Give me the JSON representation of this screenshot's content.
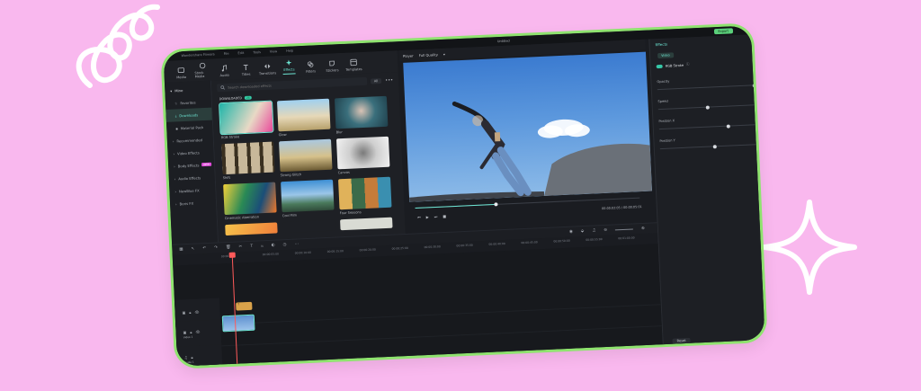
{
  "colors": {
    "background": "#f9b8ee",
    "frame_border": "#8fe36f",
    "app_bg": "#1a1c21",
    "accent": "#6ee7d5",
    "playhead": "#ff5a5a"
  },
  "topbar": {
    "menus": [
      "Wondershare Filmora",
      "File",
      "Edit",
      "Tools",
      "View",
      "Help"
    ],
    "title": "Untitled",
    "export_label": "Export"
  },
  "toolbar": {
    "tools": [
      {
        "label": "Media",
        "icon": "media-icon"
      },
      {
        "label": "Stock Media",
        "icon": "stock-media-icon"
      },
      {
        "label": "Audio",
        "icon": "audio-icon"
      },
      {
        "label": "Titles",
        "icon": "titles-icon"
      },
      {
        "label": "Transitions",
        "icon": "transitions-icon"
      },
      {
        "label": "Effects",
        "icon": "effects-icon",
        "active": true
      },
      {
        "label": "Filters",
        "icon": "filters-icon"
      },
      {
        "label": "Stickers",
        "icon": "stickers-icon"
      },
      {
        "label": "Templates",
        "icon": "templates-icon"
      }
    ]
  },
  "sidebar": {
    "items": [
      {
        "label": "Mine",
        "type": "head"
      },
      {
        "label": "Favorites",
        "type": "sub"
      },
      {
        "label": "Downloads",
        "type": "sub",
        "active": true
      },
      {
        "label": "Material Pack",
        "type": "sub"
      },
      {
        "label": "Recommended",
        "type": "item"
      },
      {
        "label": "Video Effects",
        "type": "item"
      },
      {
        "label": "Body Effects",
        "type": "item",
        "badge": "NEW"
      },
      {
        "label": "Audio Effects",
        "type": "item"
      },
      {
        "label": "NewBlue FX",
        "type": "item"
      },
      {
        "label": "Boris FX",
        "type": "item"
      }
    ]
  },
  "effects": {
    "search_placeholder": "Search downloaded effects",
    "filter_label": "All",
    "section_label": "DOWNLOADED",
    "section_count": "24",
    "cards": [
      {
        "label": "RGB Stroke",
        "selected": true
      },
      {
        "label": "Glow"
      },
      {
        "label": "Blur"
      },
      {
        "label": "Shift"
      },
      {
        "label": "Strong Glitch"
      },
      {
        "label": "Canvas"
      },
      {
        "label": "Cinematic Aberration"
      },
      {
        "label": "Cool Film"
      },
      {
        "label": "Four Seasons"
      },
      {
        "label": ""
      },
      {
        "label": ""
      },
      {
        "label": ""
      }
    ]
  },
  "player": {
    "label": "Player",
    "quality": "Full Quality",
    "current_time": "00:00:02:05",
    "total_time": "00:00:05:01"
  },
  "right_panel": {
    "tab": "Effects",
    "sub_tab": "Video",
    "effect_name": "RGB Stroke",
    "params": [
      {
        "label": "Opacity",
        "value": 1.0
      },
      {
        "label": "Speed",
        "value": 0.5
      },
      {
        "label": "Position X",
        "value": 0.7
      },
      {
        "label": "Position Y",
        "value": 0.55
      }
    ],
    "reset_label": "Reset"
  },
  "timeline": {
    "ruler": [
      "00:00",
      "00:00:05:00",
      "00:00:10:00",
      "00:00:15:00",
      "00:00:20:00",
      "00:00:25:00",
      "00:00:30:00",
      "00:00:35:00",
      "00:00:40:00",
      "00:00:45:00",
      "00:00:50:00",
      "00:00:55:00",
      "00:01:00:00",
      "00:01:05:00"
    ],
    "tracks": [
      {
        "label": "Video 2"
      },
      {
        "label": "Video 1"
      },
      {
        "label": "Audio 1"
      }
    ],
    "text_clip": "T"
  }
}
